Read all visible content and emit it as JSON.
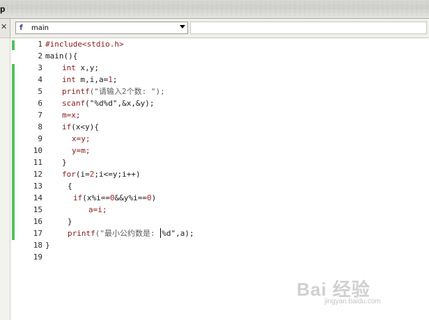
{
  "topbar": {
    "cut_label": "p"
  },
  "toolbar": {
    "close_glyph": "✕",
    "function_icon": "f",
    "function_value": "main"
  },
  "editor": {
    "lines": [
      {
        "n": "1",
        "changed": true
      },
      {
        "n": "2",
        "changed": false
      },
      {
        "n": "3",
        "changed": true
      },
      {
        "n": "4",
        "changed": true
      },
      {
        "n": "5",
        "changed": true
      },
      {
        "n": "6",
        "changed": true
      },
      {
        "n": "7",
        "changed": true
      },
      {
        "n": "8",
        "changed": true
      },
      {
        "n": "9",
        "changed": true
      },
      {
        "n": "10",
        "changed": true
      },
      {
        "n": "11",
        "changed": true
      },
      {
        "n": "12",
        "changed": true
      },
      {
        "n": "13",
        "changed": true
      },
      {
        "n": "14",
        "changed": true
      },
      {
        "n": "15",
        "changed": true
      },
      {
        "n": "16",
        "changed": true
      },
      {
        "n": "17",
        "changed": true
      },
      {
        "n": "18",
        "changed": false
      },
      {
        "n": "19",
        "changed": false
      }
    ],
    "code": {
      "l1": "#include<stdio.h>",
      "l2": "main(){",
      "l3a": "int",
      "l3b": " x,y;",
      "l4a": "int",
      "l4b": " m,i,a=",
      "l4c": "1",
      "l4d": ";",
      "l5a": "printf",
      "l5b": "(\"请输入2个数: \");",
      "l6a": "scanf",
      "l6b": "(\"%d%d\",&x,&y);",
      "l7": "m=x;",
      "l8a": "if",
      "l8b": "(x<y){",
      "l9": "x=y;",
      "l10": "y=m;",
      "l11": "}",
      "l12a": "for",
      "l12b": "(i=",
      "l12c": "2",
      "l12d": ";i<=y;i++)",
      "l13": "{",
      "l14a": "if",
      "l14b": "(x%i==",
      "l14c": "0",
      "l14d": "&&y%i==",
      "l14e": "0",
      "l14f": ")",
      "l15": "a=i;",
      "l16": "}",
      "l17a": "printf",
      "l17b": "(\"最小公约数是: ",
      "l17c": "%d\",a);",
      "l18": "}"
    }
  },
  "watermark": {
    "brand": "Bai 经验",
    "url": "jingyan.baidu.com"
  }
}
